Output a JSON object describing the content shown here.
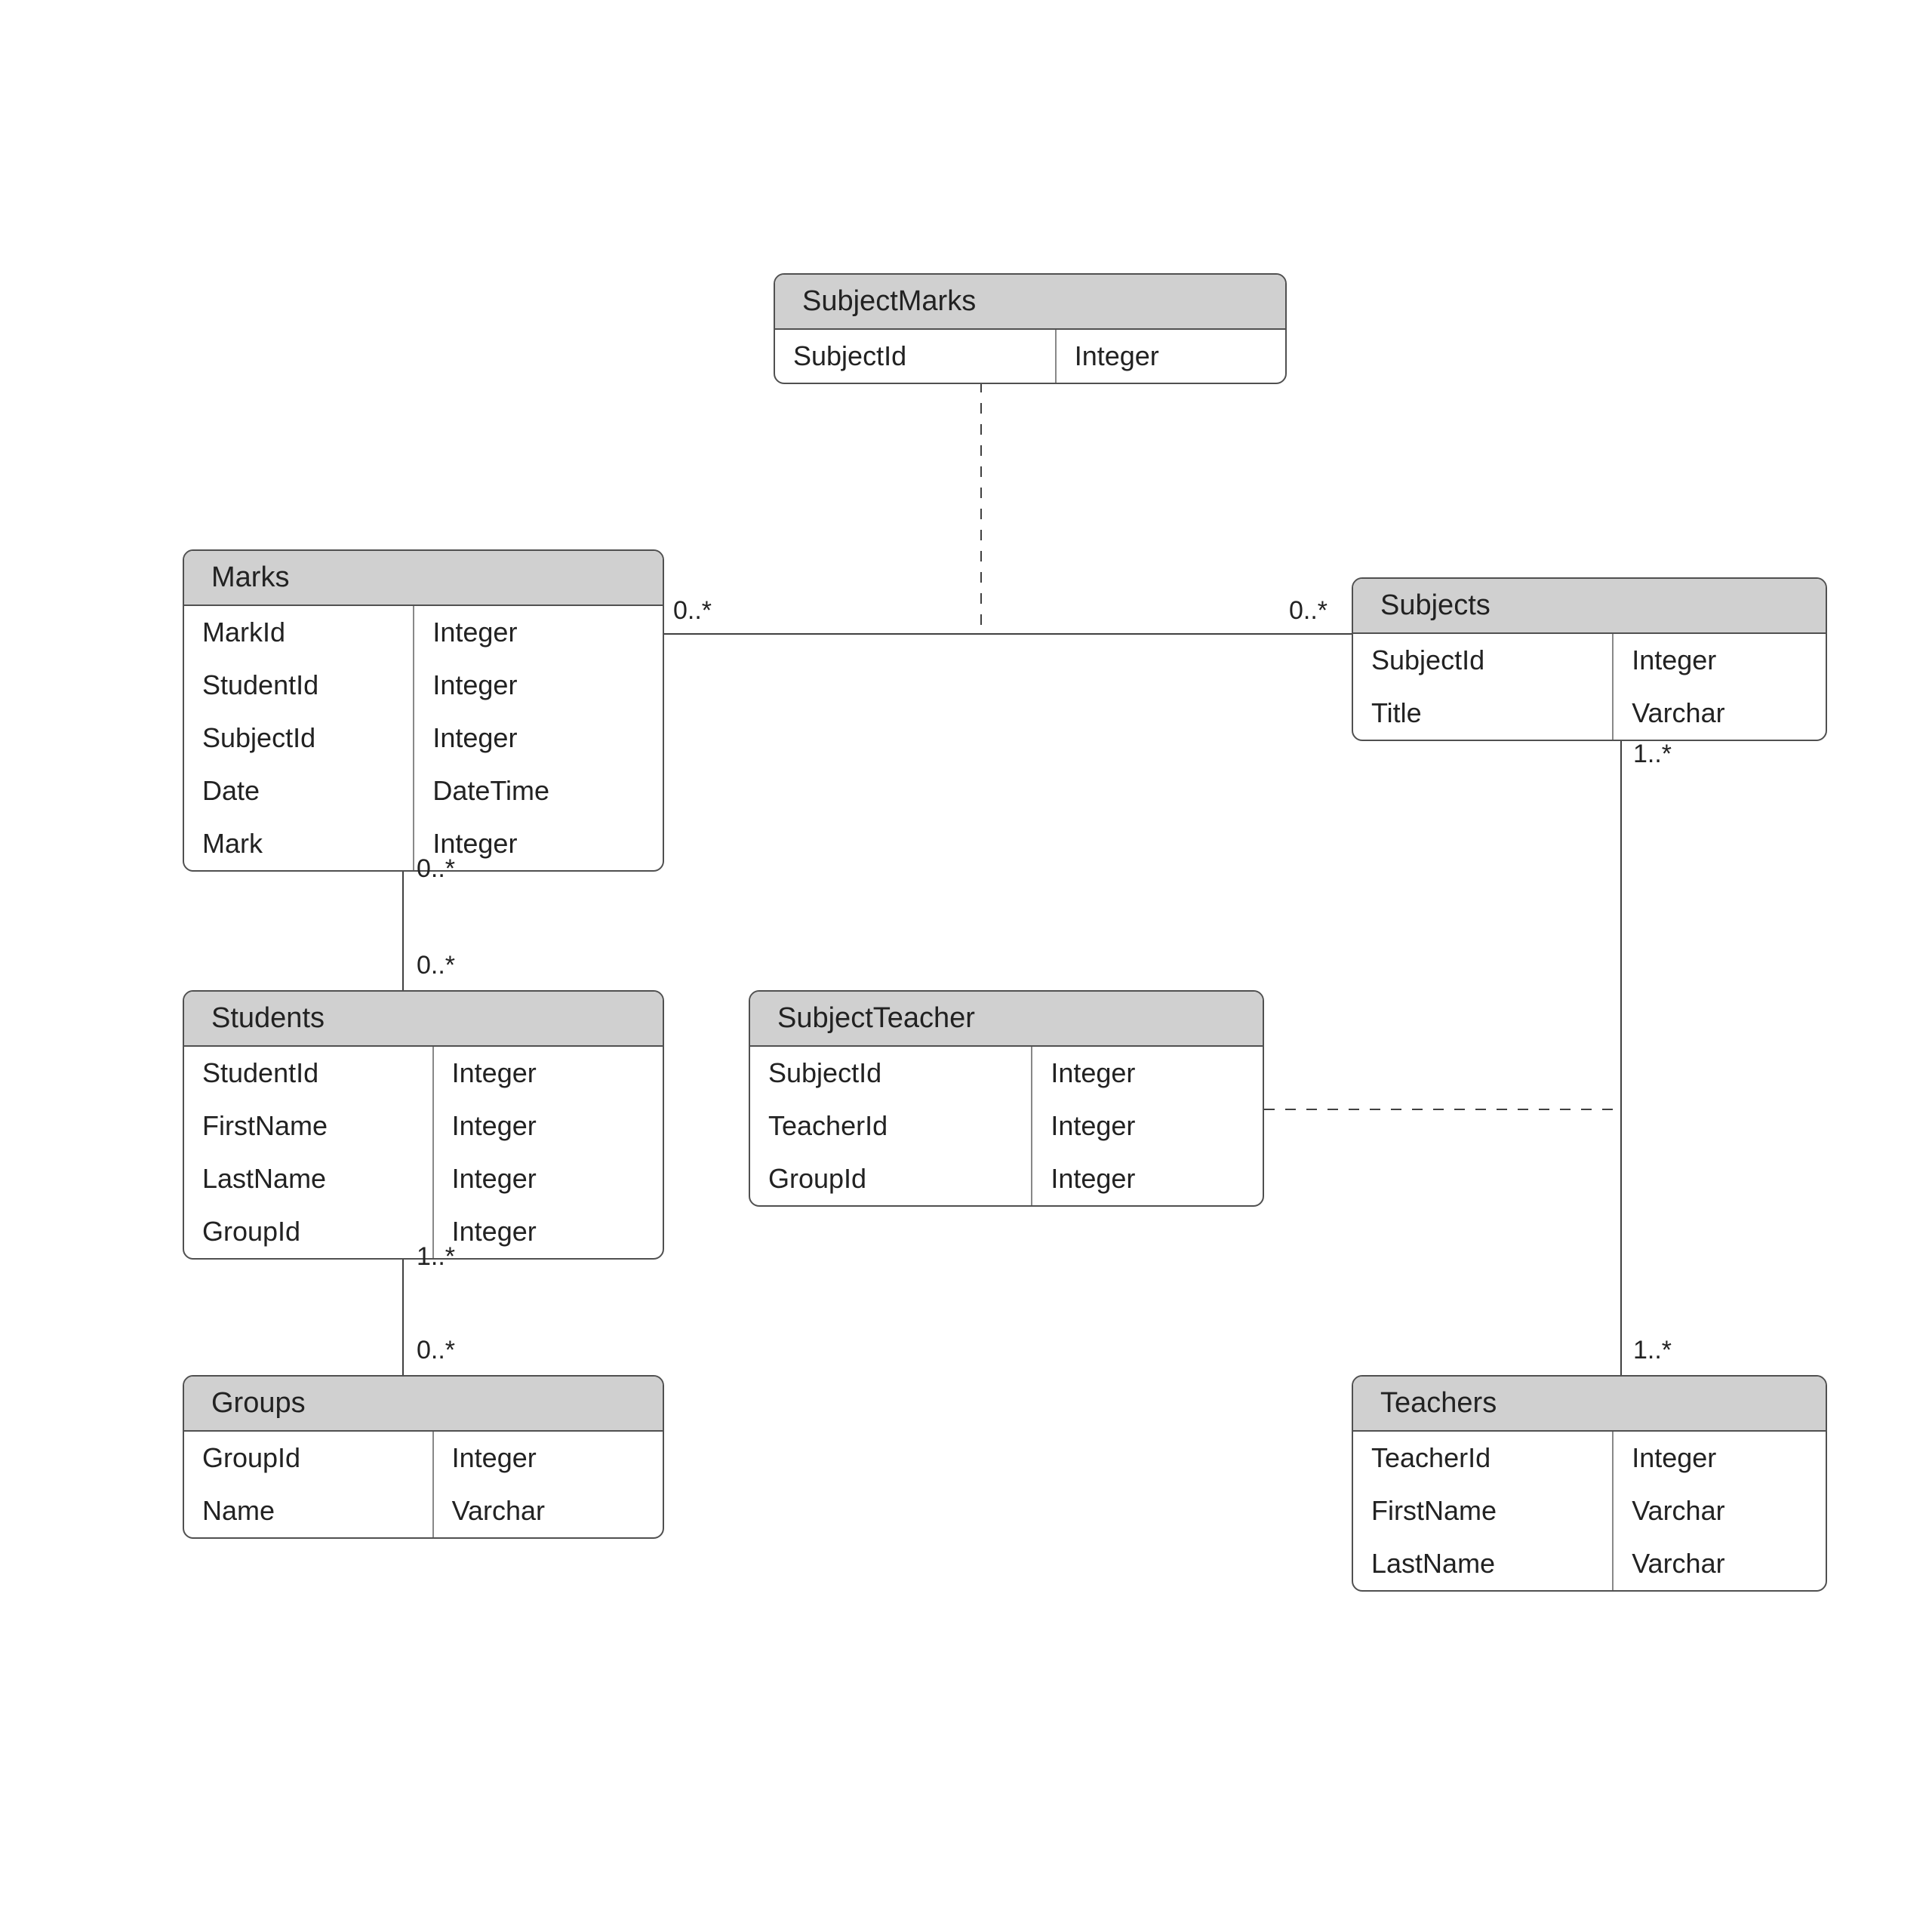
{
  "entities": {
    "subjectMarks": {
      "title": "SubjectMarks",
      "rows": [
        {
          "name": "SubjectId",
          "type": "Integer"
        }
      ]
    },
    "marks": {
      "title": "Marks",
      "rows": [
        {
          "name": "MarkId",
          "type": "Integer"
        },
        {
          "name": "StudentId",
          "type": "Integer"
        },
        {
          "name": "SubjectId",
          "type": "Integer"
        },
        {
          "name": "Date",
          "type": "DateTime"
        },
        {
          "name": "Mark",
          "type": "Integer"
        }
      ]
    },
    "subjects": {
      "title": "Subjects",
      "rows": [
        {
          "name": "SubjectId",
          "type": "Integer"
        },
        {
          "name": "Title",
          "type": "Varchar"
        }
      ]
    },
    "students": {
      "title": "Students",
      "rows": [
        {
          "name": "StudentId",
          "type": "Integer"
        },
        {
          "name": "FirstName",
          "type": "Integer"
        },
        {
          "name": "LastName",
          "type": "Integer"
        },
        {
          "name": "GroupId",
          "type": "Integer"
        }
      ]
    },
    "subjectTeacher": {
      "title": "SubjectTeacher",
      "rows": [
        {
          "name": "SubjectId",
          "type": "Integer"
        },
        {
          "name": "TeacherId",
          "type": "Integer"
        },
        {
          "name": "GroupId",
          "type": "Integer"
        }
      ]
    },
    "groups": {
      "title": "Groups",
      "rows": [
        {
          "name": "GroupId",
          "type": "Integer"
        },
        {
          "name": "Name",
          "type": "Varchar"
        }
      ]
    },
    "teachers": {
      "title": "Teachers",
      "rows": [
        {
          "name": "TeacherId",
          "type": "Integer"
        },
        {
          "name": "FirstName",
          "type": "Varchar"
        },
        {
          "name": "LastName",
          "type": "Varchar"
        }
      ]
    }
  },
  "labels": {
    "marks_subjects_left": "0..*",
    "marks_subjects_right": "0..*",
    "marks_students_top": "0..*",
    "marks_students_bottom": "0..*",
    "students_groups_top": "1..*",
    "students_groups_bottom": "0..*",
    "subjects_teachers_top": "1..*",
    "subjects_teachers_bottom": "1..*"
  }
}
